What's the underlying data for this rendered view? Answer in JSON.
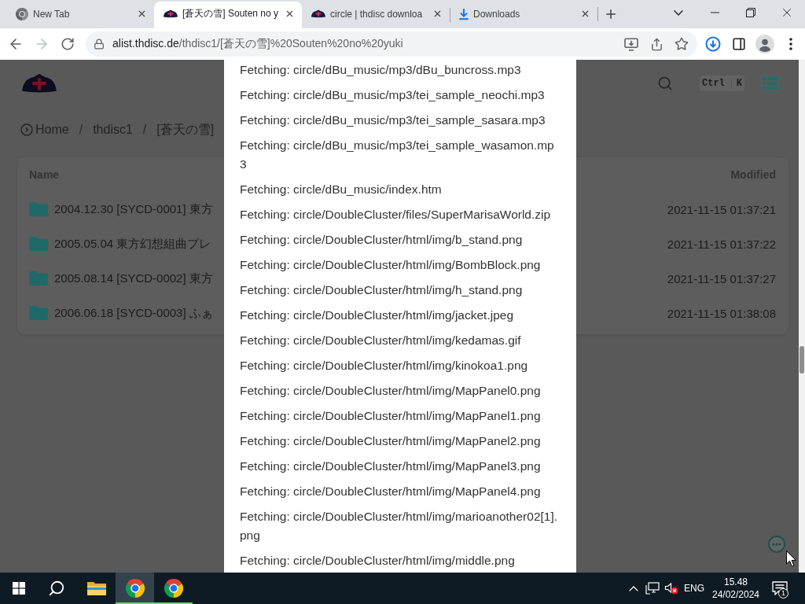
{
  "browser": {
    "tabs": [
      {
        "title": "New Tab",
        "kind": "browser",
        "selected": false
      },
      {
        "title": "[蒼天の雪] Souten no y",
        "kind": "site",
        "selected": true
      },
      {
        "title": "circle | thdisc downloa",
        "kind": "site",
        "selected": false
      },
      {
        "title": "Downloads",
        "kind": "download",
        "selected": false
      }
    ],
    "toolbar": {
      "back_disabled": false,
      "forward_disabled": true,
      "host": "alist.thdisc.de",
      "path": "/thdisc1/[蒼天の雪]%20Souten%20no%20yuki"
    }
  },
  "page": {
    "breadcrumb": [
      {
        "kind": "home",
        "label": "Home"
      },
      {
        "kind": "separator",
        "label": "/"
      },
      {
        "kind": "link",
        "label": "thdisc1"
      },
      {
        "kind": "separator",
        "label": "/"
      },
      {
        "kind": "link",
        "label": "[蒼天の雪]"
      }
    ],
    "shortcut_keys": [
      "Ctrl",
      "K"
    ],
    "table": {
      "columns": [
        "Name",
        "Modified"
      ],
      "rows": [
        {
          "name": "2004.12.30 [SYCD-0001] 東方",
          "modified": "2021-11-15 01:37:21"
        },
        {
          "name": "2005.05.04 東方幻想組曲プレ",
          "modified": "2021-11-15 01:37:22"
        },
        {
          "name": "2005.08.14 [SYCD-0002] 東方",
          "modified": "2021-11-15 01:37:27"
        },
        {
          "name": "2006.06.18 [SYCD-0003] ふぁ",
          "modified": "2021-11-15 01:38:08"
        }
      ]
    }
  },
  "download_log": {
    "lines": [
      "Fetching: circle/dBu_music/mp3/dBu_buncross.mp3",
      "Fetching: circle/dBu_music/mp3/tei_sample_neochi.mp3",
      "Fetching: circle/dBu_music/mp3/tei_sample_sasara.mp3",
      "Fetching: circle/dBu_music/mp3/tei_sample_wasamon.mp3",
      "Fetching: circle/dBu_music/index.htm",
      "Fetching: circle/DoubleCluster/files/SuperMarisaWorld.zip",
      "Fetching: circle/DoubleCluster/html/img/b_stand.png",
      "Fetching: circle/DoubleCluster/html/img/BombBlock.png",
      "Fetching: circle/DoubleCluster/html/img/h_stand.png",
      "Fetching: circle/DoubleCluster/html/img/jacket.jpeg",
      "Fetching: circle/DoubleCluster/html/img/kedamas.gif",
      "Fetching: circle/DoubleCluster/html/img/kinokoa1.png",
      "Fetching: circle/DoubleCluster/html/img/MapPanel0.png",
      "Fetching: circle/DoubleCluster/html/img/MapPanel1.png",
      "Fetching: circle/DoubleCluster/html/img/MapPanel2.png",
      "Fetching: circle/DoubleCluster/html/img/MapPanel3.png",
      "Fetching: circle/DoubleCluster/html/img/MapPanel4.png",
      "Fetching: circle/DoubleCluster/html/img/marioanother02[1].png",
      "Fetching: circle/DoubleCluster/html/img/middle.png"
    ]
  },
  "taskbar": {
    "apps": [
      {
        "kind": "explorer",
        "running": false,
        "selected": false
      },
      {
        "kind": "browser",
        "running": true,
        "selected": true
      },
      {
        "kind": "browser",
        "running": true,
        "selected": false
      }
    ],
    "tray": {
      "volume_muted": true,
      "language": "ENG",
      "time": "15.48",
      "date": "24/02/2024",
      "notification_count": "1"
    }
  }
}
